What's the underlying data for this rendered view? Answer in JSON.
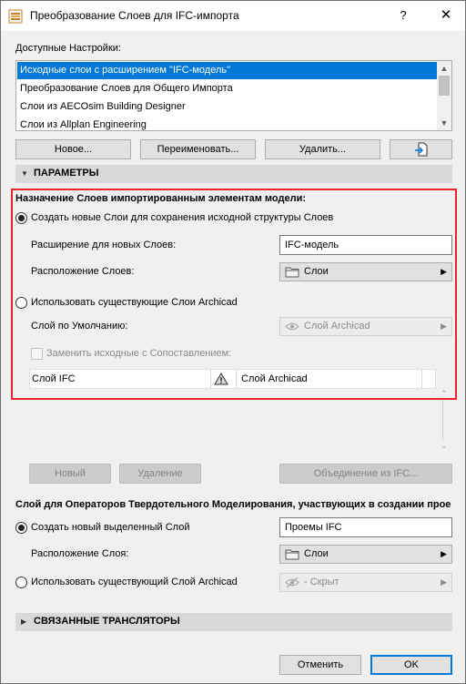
{
  "window": {
    "title": "Преобразование Слоев для IFC-импорта",
    "help": "?",
    "close": "✕"
  },
  "settings": {
    "label": "Доступные Настройки:",
    "items": [
      "Исходные слои с расширением \"IFC-модель\"",
      "Преобразование Слоев для Общего Импорта",
      "Слои из AECOsim Building Designer",
      "Слои из Allplan Engineering"
    ],
    "selected_index": 0
  },
  "settings_buttons": {
    "new": "Новое...",
    "rename": "Переименовать...",
    "delete": "Удалить..."
  },
  "parameters": {
    "header": "ПАРАМЕТРЫ",
    "assign_title": "Назначение Слоев импортированным элементам модели:",
    "create_new_label": "Создать новые Слои для сохранения исходной структуры Слоев",
    "extension_label": "Расширение для новых Слоев:",
    "extension_value": "IFC-модель",
    "location_label": "Расположение Слоев:",
    "location_value": "Слои",
    "use_existing_label": "Использовать существующие Слои Archicad",
    "default_layer_label": "Слой по Умолчанию:",
    "default_layer_value": "Слой Archicad",
    "replace_label": "Заменить исходные с Сопоставлением:",
    "table": {
      "col1": "Слой IFC",
      "col3": "Слой Archicad"
    },
    "mapping_buttons": {
      "new": "Новый",
      "delete": "Удаление",
      "merge": "Объединение из IFC..."
    }
  },
  "solid_ops": {
    "title": "Слой для Операторов Твердотельного Моделирования, участвующих в создании прое",
    "create_label": "Создать новый выделенный Слой",
    "create_value": "Проемы IFC",
    "location_label": "Расположение Слоя:",
    "location_value": "Слои",
    "use_existing_label": "Использовать существующий Слой Archicad",
    "existing_value": "- Скрыт"
  },
  "related": {
    "header": "СВЯЗАННЫЕ ТРАНСЛЯТОРЫ"
  },
  "footer": {
    "cancel": "Отменить",
    "ok": "OK"
  },
  "colors": {
    "accent": "#0078d7",
    "highlight_box": "#e8242b",
    "section_bg": "#d9d9d9"
  },
  "icons": [
    "app-icon",
    "import-icon",
    "folder-icon",
    "eye-icon",
    "warning-icon",
    "chevron-right-icon",
    "chevron-down-icon"
  ]
}
